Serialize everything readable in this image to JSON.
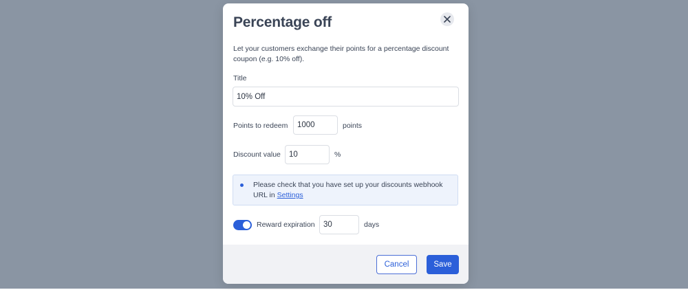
{
  "dialog": {
    "title": "Percentage off",
    "description": "Let your customers exchange their points for a percentage discount coupon (e.g. 10% off)."
  },
  "form": {
    "title_label": "Title",
    "title_value": "10% Off",
    "points_label": "Points to redeem",
    "points_value": "1000",
    "points_unit": "points",
    "discount_label": "Discount value",
    "discount_value": "10",
    "discount_unit": "%",
    "expiration_label": "Reward expiration",
    "expiration_enabled": true,
    "expiration_value": "30",
    "expiration_unit": "days"
  },
  "notice": {
    "text": "Please check that you have set up your discounts webhook URL in ",
    "link": "Settings"
  },
  "footer": {
    "cancel_label": "Cancel",
    "save_label": "Save"
  },
  "colors": {
    "accent": "#2b5fd9",
    "backdrop": "#8a95a3",
    "text": "#3a4456"
  },
  "icons": {
    "close": "close-icon",
    "notice": "bullet-icon"
  }
}
